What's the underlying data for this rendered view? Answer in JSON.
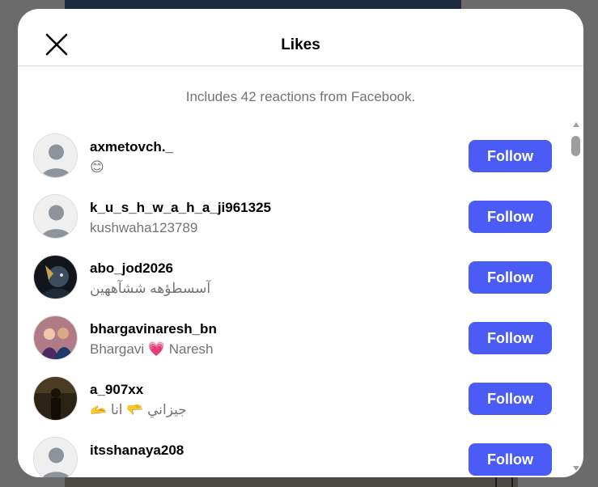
{
  "modal": {
    "title": "Likes",
    "subtitle": "Includes 42 reactions from Facebook."
  },
  "icons": {
    "close": "close-icon",
    "default_avatar": "default-avatar-icon"
  },
  "colors": {
    "follow_button": "#4a5cf5",
    "muted_text": "#737373",
    "divider": "#dbdbdb"
  },
  "users": [
    {
      "username": "axmetovch._",
      "full_name": "😊",
      "follow_label": "Follow",
      "avatar": "default"
    },
    {
      "username": "k_u_s_h_w_a_h_a_ji961325",
      "full_name": "kushwaha123789",
      "follow_label": "Follow",
      "avatar": "default"
    },
    {
      "username": "abo_jod2026",
      "full_name": "آسسطؤهه ششآههين",
      "follow_label": "Follow",
      "avatar": "photo-dark"
    },
    {
      "username": "bhargavinaresh_bn",
      "full_name": "Bhargavi 💗 Naresh",
      "follow_label": "Follow",
      "avatar": "photo-couple"
    },
    {
      "username": "a_907xx",
      "full_name": "🫴 جيزاني 🫳 انا",
      "follow_label": "Follow",
      "avatar": "photo-night"
    },
    {
      "username": "itsshanaya208",
      "full_name": "",
      "follow_label": "Follow",
      "avatar": "default"
    }
  ]
}
